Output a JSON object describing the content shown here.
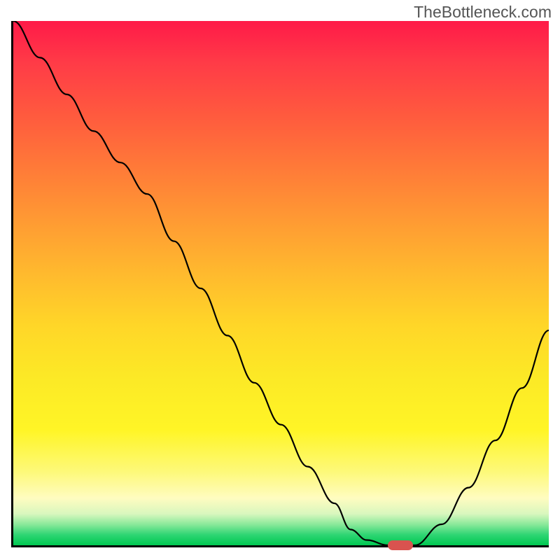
{
  "watermark": "TheBottleneck.com",
  "chart_data": {
    "type": "line",
    "title": "",
    "xlabel": "",
    "ylabel": "",
    "xlim": [
      0,
      100
    ],
    "ylim": [
      0,
      100
    ],
    "x": [
      0,
      5,
      10,
      15,
      20,
      25,
      30,
      35,
      40,
      45,
      50,
      55,
      60,
      63,
      66,
      70,
      75,
      80,
      85,
      90,
      95,
      100
    ],
    "values": [
      100,
      93,
      86,
      79,
      73,
      67,
      58,
      49,
      40,
      31,
      23,
      15,
      8,
      3,
      1,
      0,
      0,
      4,
      11,
      20,
      30,
      41
    ],
    "marker": {
      "x": 72,
      "y": 0
    },
    "gradient_stops": [
      {
        "pos": 0,
        "color": "#ff1a48"
      },
      {
        "pos": 50,
        "color": "#ffd628"
      },
      {
        "pos": 100,
        "color": "#00c851"
      }
    ]
  }
}
